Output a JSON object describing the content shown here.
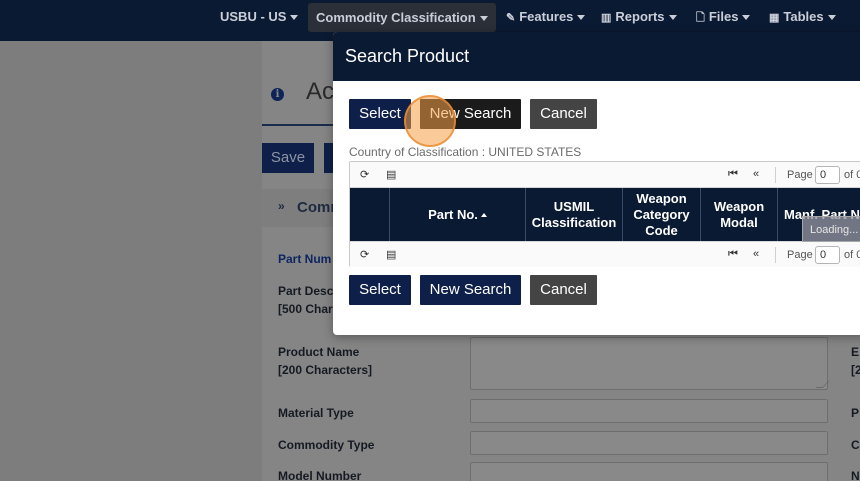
{
  "nav": {
    "items": [
      {
        "label": "USBU - US"
      },
      {
        "label": "Commodity Classification"
      },
      {
        "label": "Features",
        "icon": "pencil-icon"
      },
      {
        "label": "Reports",
        "icon": "bar-chart-icon"
      },
      {
        "label": "Files",
        "icon": "file-icon"
      },
      {
        "label": "Tables",
        "icon": "table-icon"
      }
    ]
  },
  "page": {
    "title": "Ac",
    "save_label": "Save",
    "section_label": "Comm",
    "fields": [
      {
        "label": "Part Num"
      },
      {
        "label": "Part Desc",
        "sub": "[500 Char"
      },
      {
        "label": "Product Name",
        "sub": "[200 Characters]"
      },
      {
        "label": "Material Type"
      },
      {
        "label": "Commodity Type"
      },
      {
        "label": "Model Number"
      }
    ],
    "right_labels": [
      "E",
      "[2",
      "P",
      "C",
      "N"
    ]
  },
  "modal": {
    "title": "Search Product",
    "buttons": {
      "select": "Select",
      "new_search": "New Search",
      "cancel": "Cancel"
    },
    "country": "Country of Classification : UNITED STATES",
    "pager": {
      "page_label": "Page",
      "page_value": "0",
      "of_label": "of 0"
    },
    "columns": [
      {
        "label": ""
      },
      {
        "label": "Part No."
      },
      {
        "label": "USMIL Classification"
      },
      {
        "label": "Weapon Category Code"
      },
      {
        "label": "Weapon Modal"
      },
      {
        "label": "Manf. Part N"
      }
    ],
    "loading": "Loading..."
  },
  "colors": {
    "navy": "#0b1a33",
    "primary_button": "#0e2049",
    "cancel_button": "#444444"
  }
}
